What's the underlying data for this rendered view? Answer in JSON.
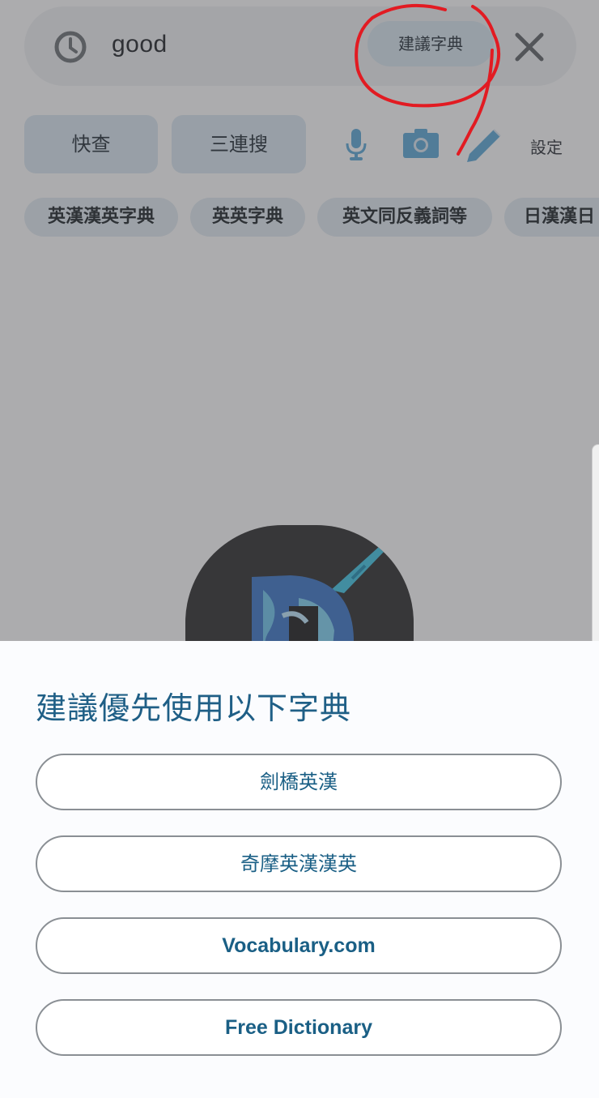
{
  "search": {
    "query": "good",
    "suggest_label": "建議字典"
  },
  "modes": {
    "quick": "快查",
    "triple": "三連搜",
    "settings": "設定"
  },
  "chips": [
    "英漢漢英字典",
    "英英字典",
    "英文同反義詞等",
    "日漢漢日"
  ],
  "sheet": {
    "title": "建議優先使用以下字典",
    "options": [
      "劍橋英漢",
      "奇摩英漢漢英",
      "Vocabulary.com",
      "Free Dictionary"
    ]
  },
  "colors": {
    "accent": "#1a5f85",
    "chip_bg": "#e2ebf2",
    "annotation": "#e21b22"
  },
  "icons": [
    "history-icon",
    "close-icon",
    "microphone-icon",
    "camera-icon",
    "pencil-icon"
  ]
}
